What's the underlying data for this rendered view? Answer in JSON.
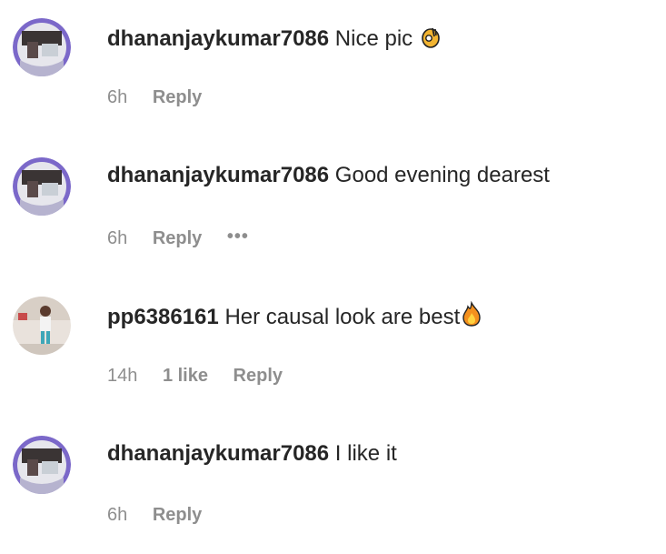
{
  "comments": [
    {
      "username": "dhananjaykumar7086",
      "text": "Nice pic",
      "emoji": "ok-hand-emoji",
      "time": "6h",
      "likes": "",
      "reply_label": "Reply",
      "show_more": false
    },
    {
      "username": "dhananjaykumar7086",
      "text": "Good evening dearest",
      "emoji": "",
      "time": "6h",
      "likes": "",
      "reply_label": "Reply",
      "show_more": true,
      "more_label": "•••"
    },
    {
      "username": "pp6386161",
      "text": "Her causal look are best",
      "emoji": "fire-emoji",
      "time": "14h",
      "likes": "1 like",
      "reply_label": "Reply",
      "show_more": false
    },
    {
      "username": "dhananjaykumar7086",
      "text": "I like it",
      "emoji": "",
      "time": "6h",
      "likes": "",
      "reply_label": "Reply",
      "show_more": false
    }
  ],
  "colors": {
    "text": "#262626",
    "meta": "#8e8e8e",
    "avatar_ring": "#7b68c9"
  }
}
